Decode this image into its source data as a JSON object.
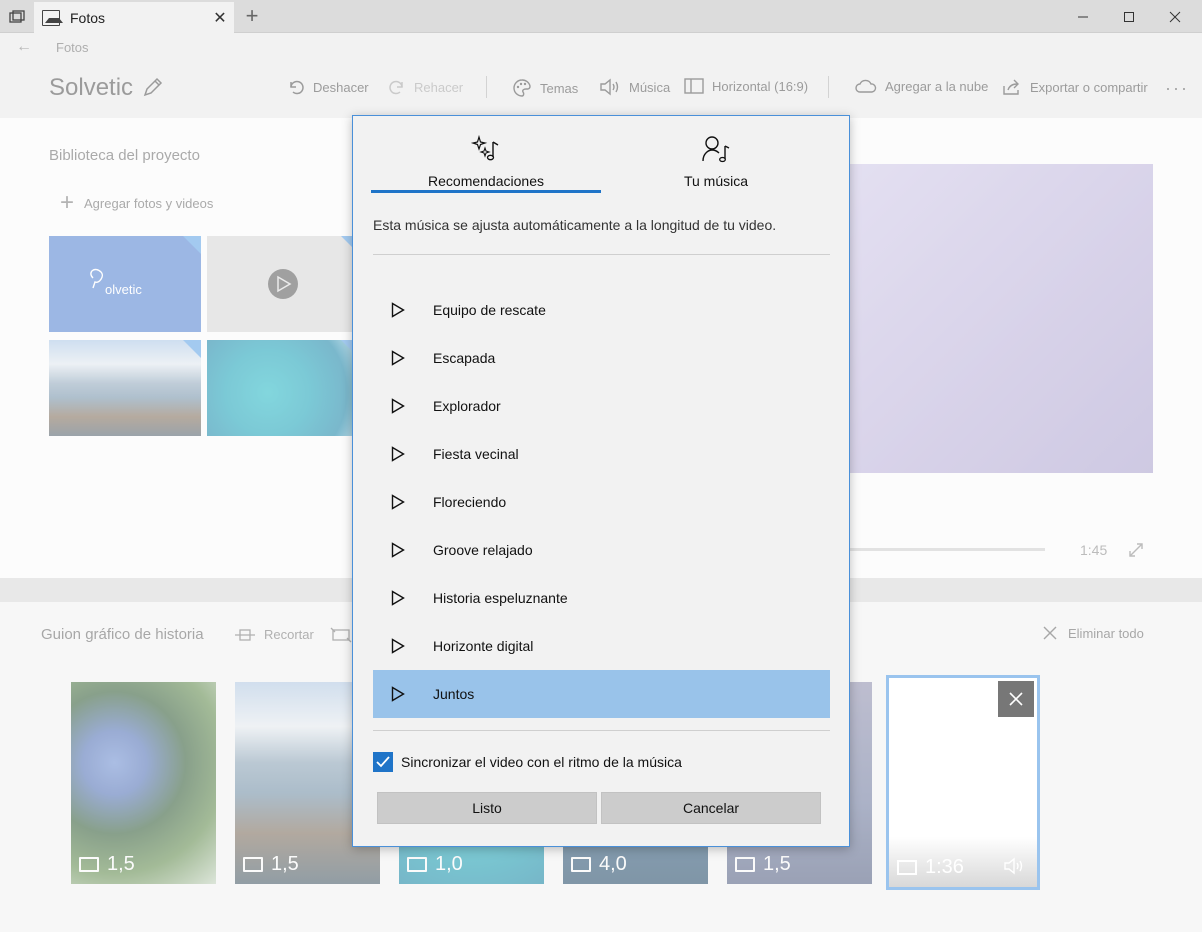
{
  "window": {
    "tab_title": "Fotos",
    "new_tab": "+",
    "close_tab": "✕"
  },
  "app": {
    "back_label": "Fotos",
    "project_title": "Solvetic"
  },
  "toolbar": {
    "undo": "Deshacer",
    "redo": "Rehacer",
    "themes": "Temas",
    "music": "Música",
    "aspect": "Horizontal (16:9)",
    "cloud": "Agregar a la nube",
    "export": "Exportar o compartir",
    "more": "···"
  },
  "library": {
    "title": "Biblioteca del proyecto",
    "add_label": "Agregar fotos y videos",
    "logo_text": "olvetic"
  },
  "preview": {
    "duration": "1:45"
  },
  "storyboard": {
    "title": "Guion gráfico de historia",
    "trim": "Recortar",
    "delete_all": "Eliminar todo",
    "cards": [
      {
        "duration": "1,5"
      },
      {
        "duration": "1,5"
      },
      {
        "duration": "1,0"
      },
      {
        "duration": "4,0"
      },
      {
        "duration": "1,5"
      }
    ],
    "selected_duration": "1:36"
  },
  "dialog": {
    "tab_recommendations": "Recomendaciones",
    "tab_your_music": "Tu música",
    "description": "Esta música se ajusta automáticamente a la longitud de tu video.",
    "songs": [
      "Equipo de rescate",
      "Escapada",
      "Explorador",
      "Fiesta vecinal",
      "Floreciendo",
      "Groove relajado",
      "Historia espeluznante",
      "Horizonte digital",
      "Juntos"
    ],
    "selected_song_index": 8,
    "sync_label": "Sincronizar el video con el ritmo de la música",
    "sync_checked": true,
    "ok_button": "Listo",
    "cancel_button": "Cancelar"
  },
  "colors": {
    "accent": "#1f74c8",
    "selected_row": "#99c3ea",
    "preview": "#b8aed8"
  }
}
